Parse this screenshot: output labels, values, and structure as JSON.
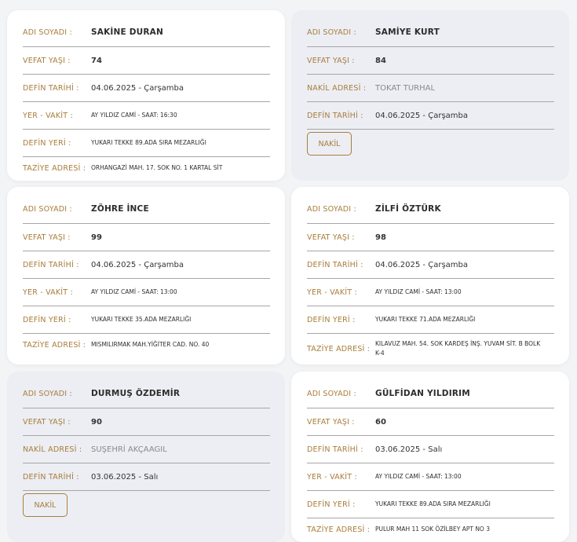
{
  "labels": {
    "name": "ADI SOYADI :",
    "age": "VEFAT YAŞI :",
    "burial_date": "DEFİN TARİHİ :",
    "place_time": "YER - VAKİT :",
    "burial_place": "DEFİN YERİ :",
    "condolence": "TAZİYE ADRESİ :",
    "transfer": "NAKİL ADRESİ :"
  },
  "button": {
    "nakil": "NAKİL"
  },
  "cards": [
    {
      "name": "SAKİNE DURAN",
      "age": "74",
      "burial_date": "04.06.2025 - Çarşamba",
      "place_time": "AY YILDIZ CAMİ - SAAT: 16:30",
      "burial_place": "YUKARI TEKKE 89.ADA SIRA MEZARLIĞI",
      "condolence": "ORHANGAZİ MAH. 17. SOK NO. 1 KARTAL SİT"
    },
    {
      "name": "SAMİYE KURT",
      "age": "84",
      "transfer": "TOKAT TURHAL",
      "burial_date": "04.06.2025 - Çarşamba"
    },
    {
      "name": "ZÖHRE İNCE",
      "age": "99",
      "burial_date": "04.06.2025 - Çarşamba",
      "place_time": "AY YILDIZ CAMİ - SAAT: 13:00",
      "burial_place": "YUKARI TEKKE 35.ADA MEZARLIĞI",
      "condolence": "MISMILIRMAK MAH.YİĞİTER CAD. NO. 40"
    },
    {
      "name": "ZİLFİ ÖZTÜRK",
      "age": "98",
      "burial_date": "04.06.2025 - Çarşamba",
      "place_time": "AY YILDIZ CAMİ - SAAT: 13:00",
      "burial_place": "YUKARI TEKKE 71.ADA MEZARLIĞI",
      "condolence": "KILAVUZ MAH. 54. SOK KARDEŞ İNŞ. YUVAM SİT. B BOLK K-4"
    },
    {
      "name": "DURMUŞ ÖZDEMİR",
      "age": "90",
      "transfer": "SUŞEHRİ AKÇAAGIL",
      "burial_date": "03.06.2025 - Salı"
    },
    {
      "name": "GÜLFİDAN YILDIRIM",
      "age": "60",
      "burial_date": "03.06.2025 - Salı",
      "place_time": "AY YILDIZ CAMİ - SAAT: 13:00",
      "burial_place": "YUKARI TEKKE 89.ADA SIRA MEZARLIĞI",
      "condolence": "PULUR MAH 11 SOK ÖZİLBEY APT NO 3"
    }
  ]
}
